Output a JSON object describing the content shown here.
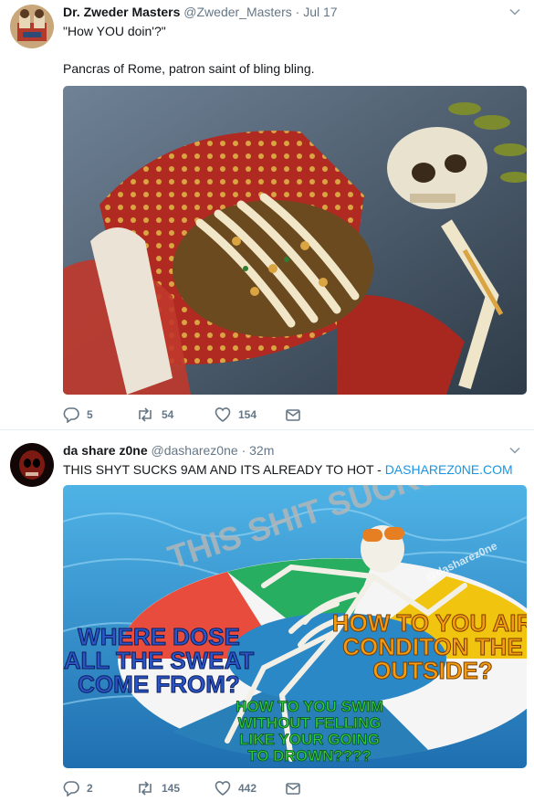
{
  "tweets": [
    {
      "name": "Dr. Zweder Masters",
      "handle": "@Zweder_Masters",
      "separator": "·",
      "time": "Jul 17",
      "text_line1": "\"How YOU doin'?\"",
      "text_line2": "Pancras of Rome, patron saint of bling bling.",
      "media_description_icon": "jeweled-skeleton-image",
      "actions": {
        "replies": "5",
        "retweets": "54",
        "likes": "154"
      }
    },
    {
      "name": "da share z0ne",
      "handle": "@dasharez0ne",
      "separator": "·",
      "time": "32m",
      "text_prefix": "THIS SHYT SUCKS 9AM AND ITS ALREADY TO HOT - ",
      "text_link": "DASHAREZ0NE.COM",
      "media": {
        "title": "THIS SHIT SUCKS",
        "watermark": "@dasharez0ne",
        "caption_left": [
          "WHERE DOSE",
          "ALL THE SWEAT",
          "COME FROM?"
        ],
        "caption_right": [
          "HOW TO YOU AIR",
          "CONDITON THE",
          "OUTSIDE?"
        ],
        "caption_bottom": [
          "HOW TO YOU SWIM",
          "WITHOUT FELLING",
          "LIKE YOUR GOING",
          "TO DROWN????"
        ]
      },
      "actions": {
        "replies": "2",
        "retweets": "145",
        "likes": "442"
      }
    }
  ],
  "colors": {
    "link": "#1b95e0",
    "muted": "#657786",
    "text": "#14171a",
    "divider": "#e6ecf0"
  }
}
